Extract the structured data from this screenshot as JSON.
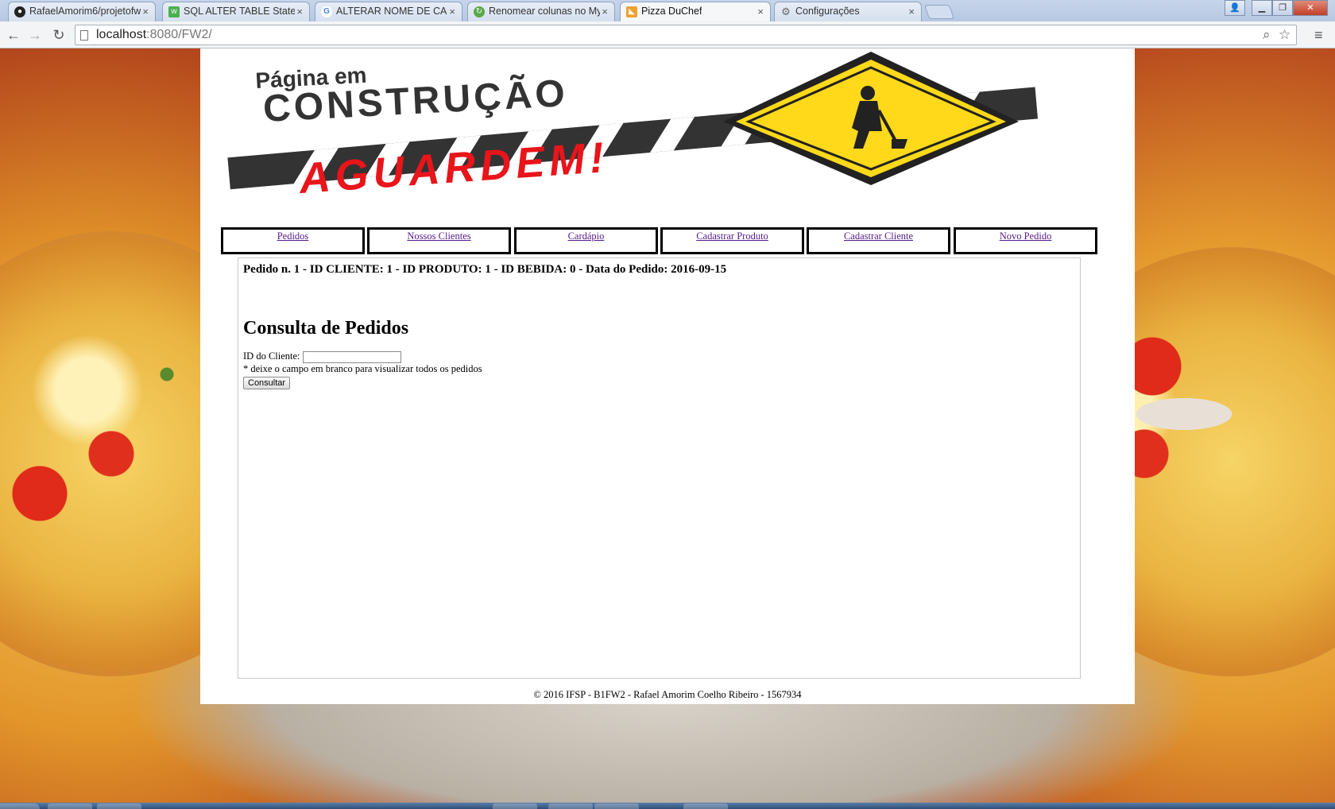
{
  "browser": {
    "tabs": [
      {
        "title": "RafaelAmorim6/projetofw",
        "icon": "github-icon"
      },
      {
        "title": "SQL ALTER TABLE Stateme",
        "icon": "w3schools-icon"
      },
      {
        "title": "ALTERAR NOME DE CAMP",
        "icon": "google-icon"
      },
      {
        "title": "Renomear colunas no MyS",
        "icon": "refresh-icon"
      },
      {
        "title": "Pizza DuChef",
        "icon": "pizza-icon"
      },
      {
        "title": "Configurações",
        "icon": "gear-icon"
      }
    ],
    "url_host": "localhost",
    "url_rest": ":8080/FW2/"
  },
  "site": {
    "banner": {
      "line1": "Página em",
      "line2": "CONSTRUÇÃO",
      "line3": "AGUARDEM!"
    },
    "nav": [
      "Pedidos",
      "Nossos Clientes",
      "Cardápio",
      "Cadastrar Produto",
      "Cadastrar Cliente",
      "Novo Pedido"
    ],
    "order_line": "Pedido n. 1 - ID CLIENTE: 1 - ID PRODUTO: 1 - ID BEBIDA: 0 - Data do Pedido: 2016-09-15",
    "heading": "Consulta de Pedidos",
    "form": {
      "label": "ID do Cliente:",
      "value": "",
      "hint": "* deixe o campo em branco para visualizar todos os pedidos",
      "submit": "Consultar"
    },
    "footer": "© 2016 IFSP - B1FW2 - Rafael Amorim Coelho Ribeiro - 1567934"
  },
  "colors": {
    "link": "#551a8b",
    "banner_red": "#e8151b",
    "banner_dark": "#333333",
    "sign_yellow": "#ffd91a"
  }
}
